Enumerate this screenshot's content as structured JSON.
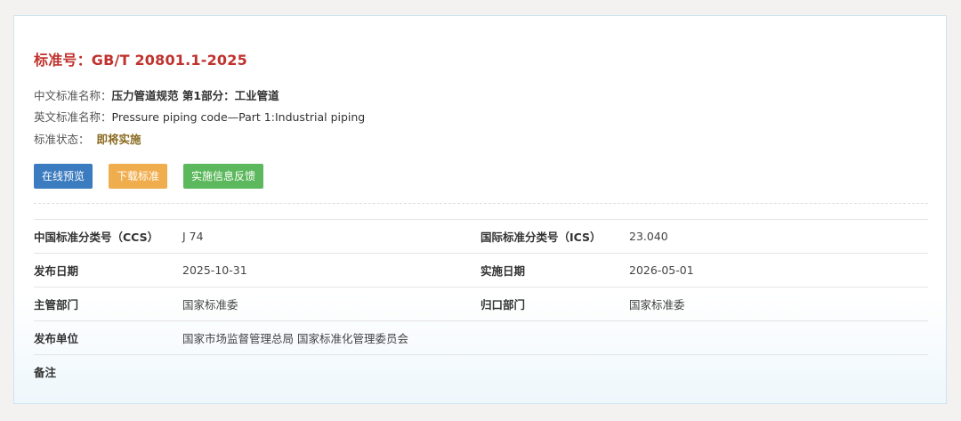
{
  "standard": {
    "title": "标准号：GB/T 20801.1-2025",
    "cn_name_label": "中文标准名称：",
    "cn_name": "压力管道规范 第1部分：工业管道",
    "en_name_label": "英文标准名称：",
    "en_name": "Pressure piping code—Part 1:Industrial piping",
    "status_label": "标准状态：",
    "status": "即将实施"
  },
  "buttons": {
    "preview": "在线预览",
    "download": "下载标准",
    "feedback": "实施信息反馈"
  },
  "colors": {
    "title": "#c0322d",
    "status": "#8a6a20",
    "preview_btn": "#3b7bbf",
    "download_btn": "#f0ad4e",
    "feedback_btn": "#5cb85c"
  },
  "details": {
    "ccs_label": "中国标准分类号（CCS）",
    "ccs_value": "J 74",
    "ics_label": "国际标准分类号（ICS）",
    "ics_value": "23.040",
    "publish_date_label": "发布日期",
    "publish_date_value": "2025-10-31",
    "implement_date_label": "实施日期",
    "implement_date_value": "2026-05-01",
    "competent_dept_label": "主管部门",
    "competent_dept_value": "国家标准委",
    "centralized_dept_label": "归口部门",
    "centralized_dept_value": "国家标准委",
    "issuer_label": "发布单位",
    "issuer_value": "国家市场监督管理总局 国家标准化管理委员会",
    "remarks_label": "备注",
    "remarks_value": ""
  }
}
